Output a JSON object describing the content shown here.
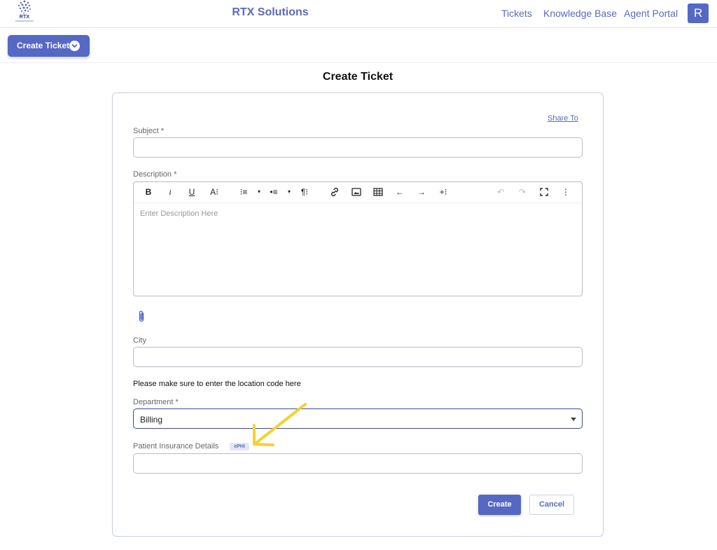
{
  "header": {
    "logo_text": "RTX",
    "brand": "RTX Solutions",
    "nav": [
      "Tickets",
      "Knowledge Base",
      "Agent Portal"
    ],
    "avatar_initial": "R"
  },
  "toolbar": {
    "create_ticket_label": "Create Ticket"
  },
  "page": {
    "title": "Create Ticket"
  },
  "form": {
    "share_to": "Share To",
    "subject_label": "Subject *",
    "subject_value": "",
    "description_label": "Description *",
    "description_placeholder": "Enter Description Here",
    "editor_tools": {
      "bold": "B",
      "italic": "i",
      "underline": "U",
      "font_size": "A⁝",
      "ordered_list": "⁝≡",
      "bullet_list": "•≡",
      "paragraph": "¶⁝",
      "link": "🔗",
      "image": "▣",
      "table": "⊞",
      "undo_arrow": "←",
      "redo_arrow": "→",
      "insert": "+⁝",
      "undo": "↶",
      "redo": "↷",
      "fullscreen": "⛶",
      "more": "⋮"
    },
    "city_label": "City",
    "city_value": "",
    "location_note": "Please make sure to enter the location code here",
    "department_label": "Department *",
    "department_value": "Billing",
    "insurance_label": "Patient Insurance Details",
    "insurance_badge": "ePHI",
    "insurance_value": "",
    "create_label": "Create",
    "cancel_label": "Cancel"
  },
  "colors": {
    "accent": "#5468c4",
    "annotation_arrow": "#f5d130"
  }
}
